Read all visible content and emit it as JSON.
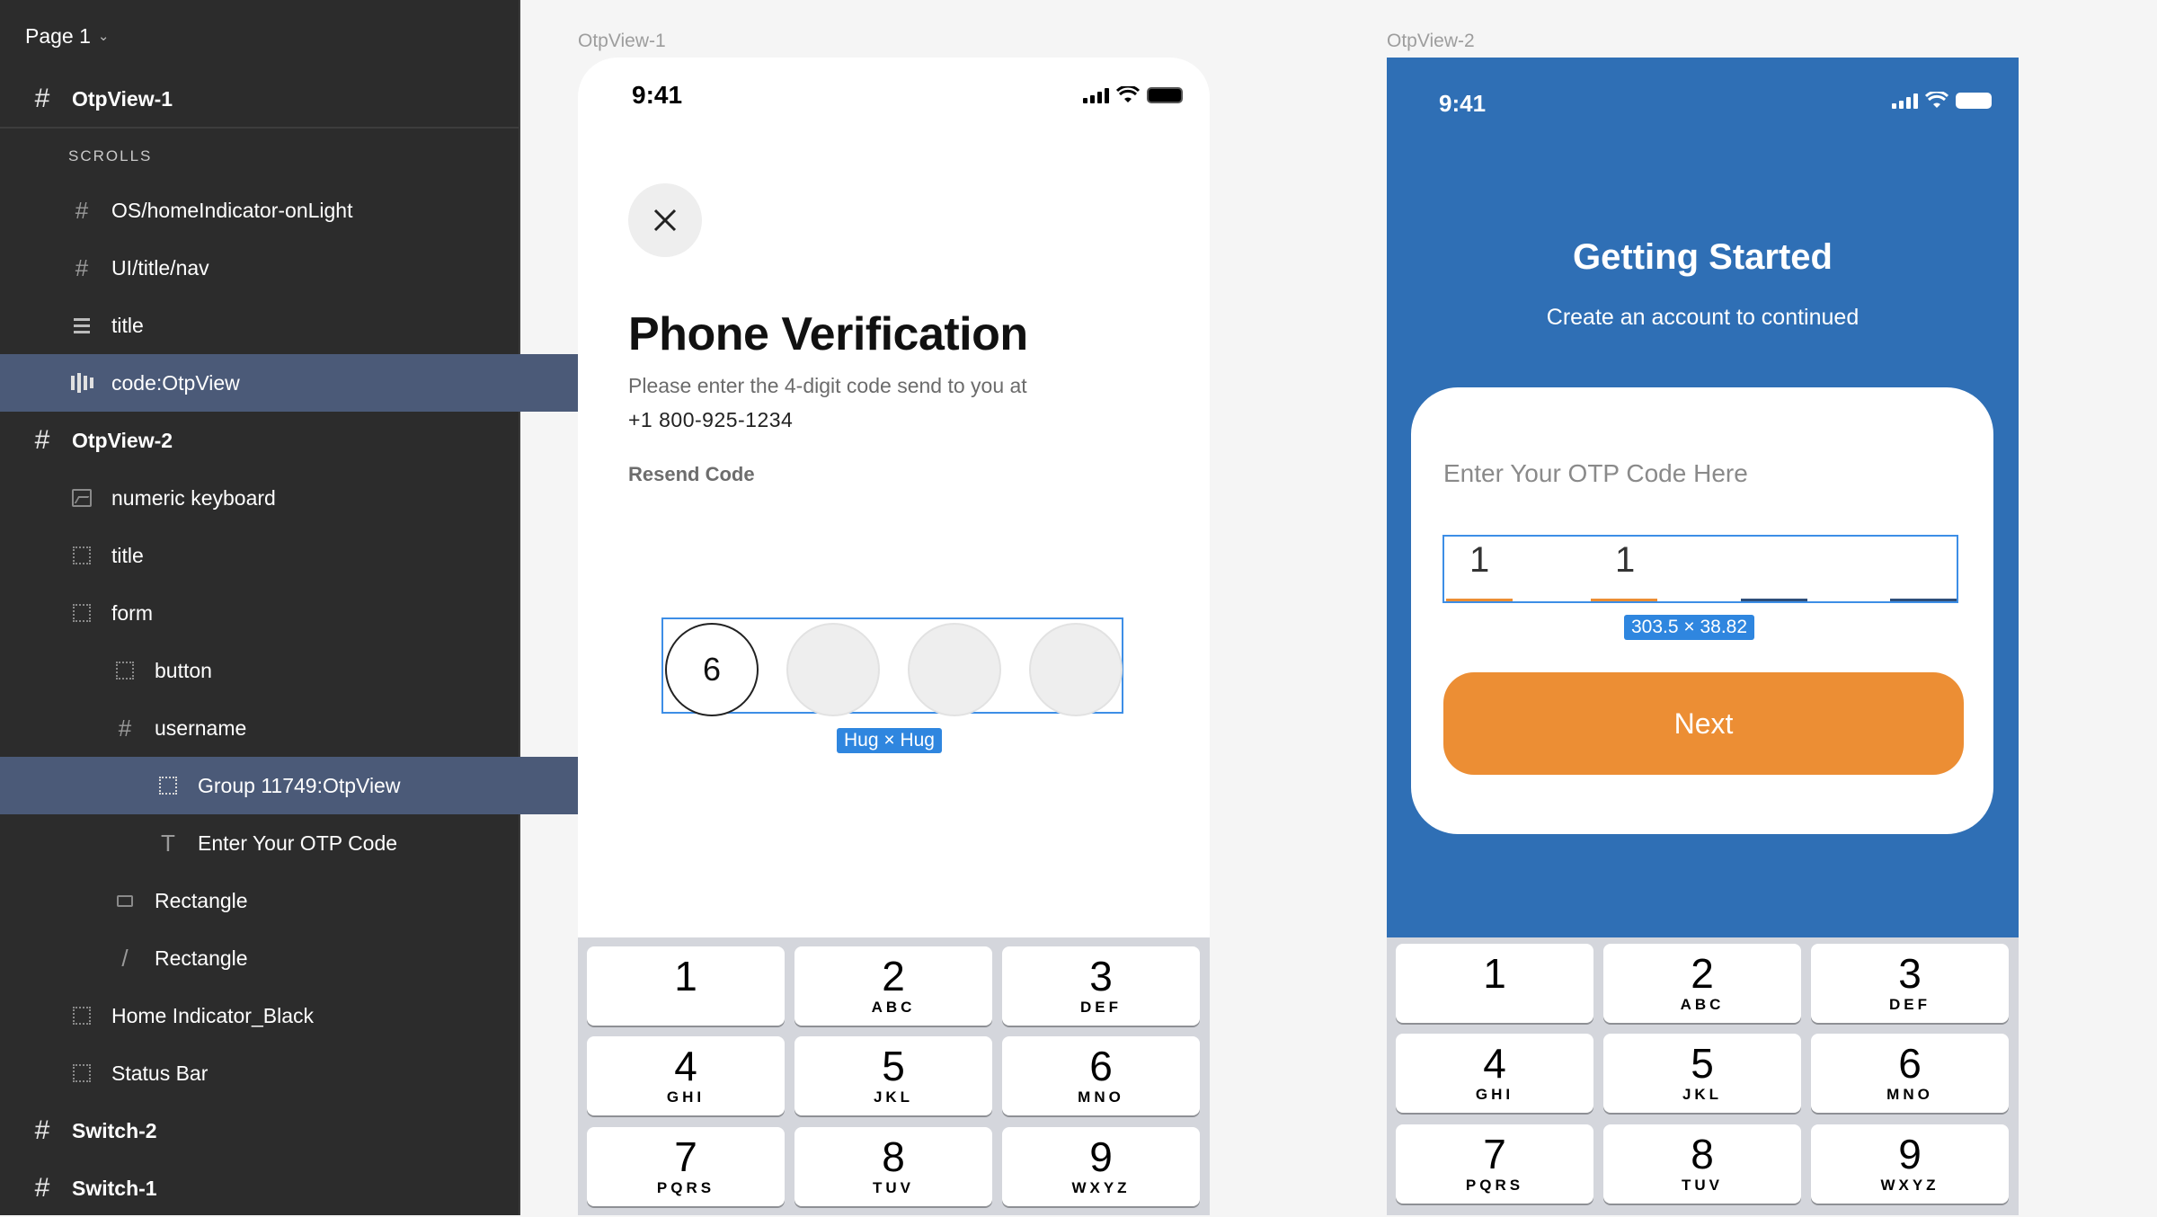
{
  "layers_panel": {
    "page_label": "Page 1",
    "section_label": "SCROLLS",
    "items": [
      {
        "label": "OtpView-1"
      },
      {
        "label": "OS/homeIndicator-onLight"
      },
      {
        "label": "UI/title/nav"
      },
      {
        "label": "title"
      },
      {
        "label": "code:OtpView"
      },
      {
        "label": "OtpView-2"
      },
      {
        "label": "numeric keyboard"
      },
      {
        "label": "title"
      },
      {
        "label": "form"
      },
      {
        "label": "button"
      },
      {
        "label": "username"
      },
      {
        "label": "Group 11749:OtpView"
      },
      {
        "label": "Enter Your OTP Code"
      },
      {
        "label": "Rectangle"
      },
      {
        "label": "Rectangle"
      },
      {
        "label": "Home Indicator_Black"
      },
      {
        "label": "Status Bar"
      },
      {
        "label": "Switch-2"
      },
      {
        "label": "Switch-1"
      }
    ]
  },
  "frame1": {
    "label": "OtpView-1",
    "time": "9:41",
    "title": "Phone Verification",
    "subtitle": "Please enter the 4-digit code send to you at",
    "phone": "+1  800-925-1234",
    "resend": "Resend Code",
    "otp_digits": [
      "6",
      "",
      "",
      ""
    ],
    "size_badge": "Hug × Hug"
  },
  "frame2": {
    "label": "OtpView-2",
    "time": "9:41",
    "title": "Getting Started",
    "subtitle": "Create an account to continued",
    "hint": "Enter Your OTP Code Here",
    "otp_digits": [
      "1",
      "1",
      "",
      ""
    ],
    "size_badge": "303.5 × 38.82",
    "next_label": "Next"
  },
  "keyboard": {
    "keys": [
      {
        "n": "1",
        "l": ""
      },
      {
        "n": "2",
        "l": "ABC"
      },
      {
        "n": "3",
        "l": "DEF"
      },
      {
        "n": "4",
        "l": "GHI"
      },
      {
        "n": "5",
        "l": "JKL"
      },
      {
        "n": "6",
        "l": "MNO"
      },
      {
        "n": "7",
        "l": "PQRS"
      },
      {
        "n": "8",
        "l": "TUV"
      },
      {
        "n": "9",
        "l": "WXYZ"
      }
    ]
  },
  "colors": {
    "panel_bg": "#2c2c2c",
    "selection": "#4b5a78",
    "frame2_bg": "#2f6fb5",
    "accent_orange": "#ec8e34",
    "selection_blue": "#3d8ee6"
  }
}
